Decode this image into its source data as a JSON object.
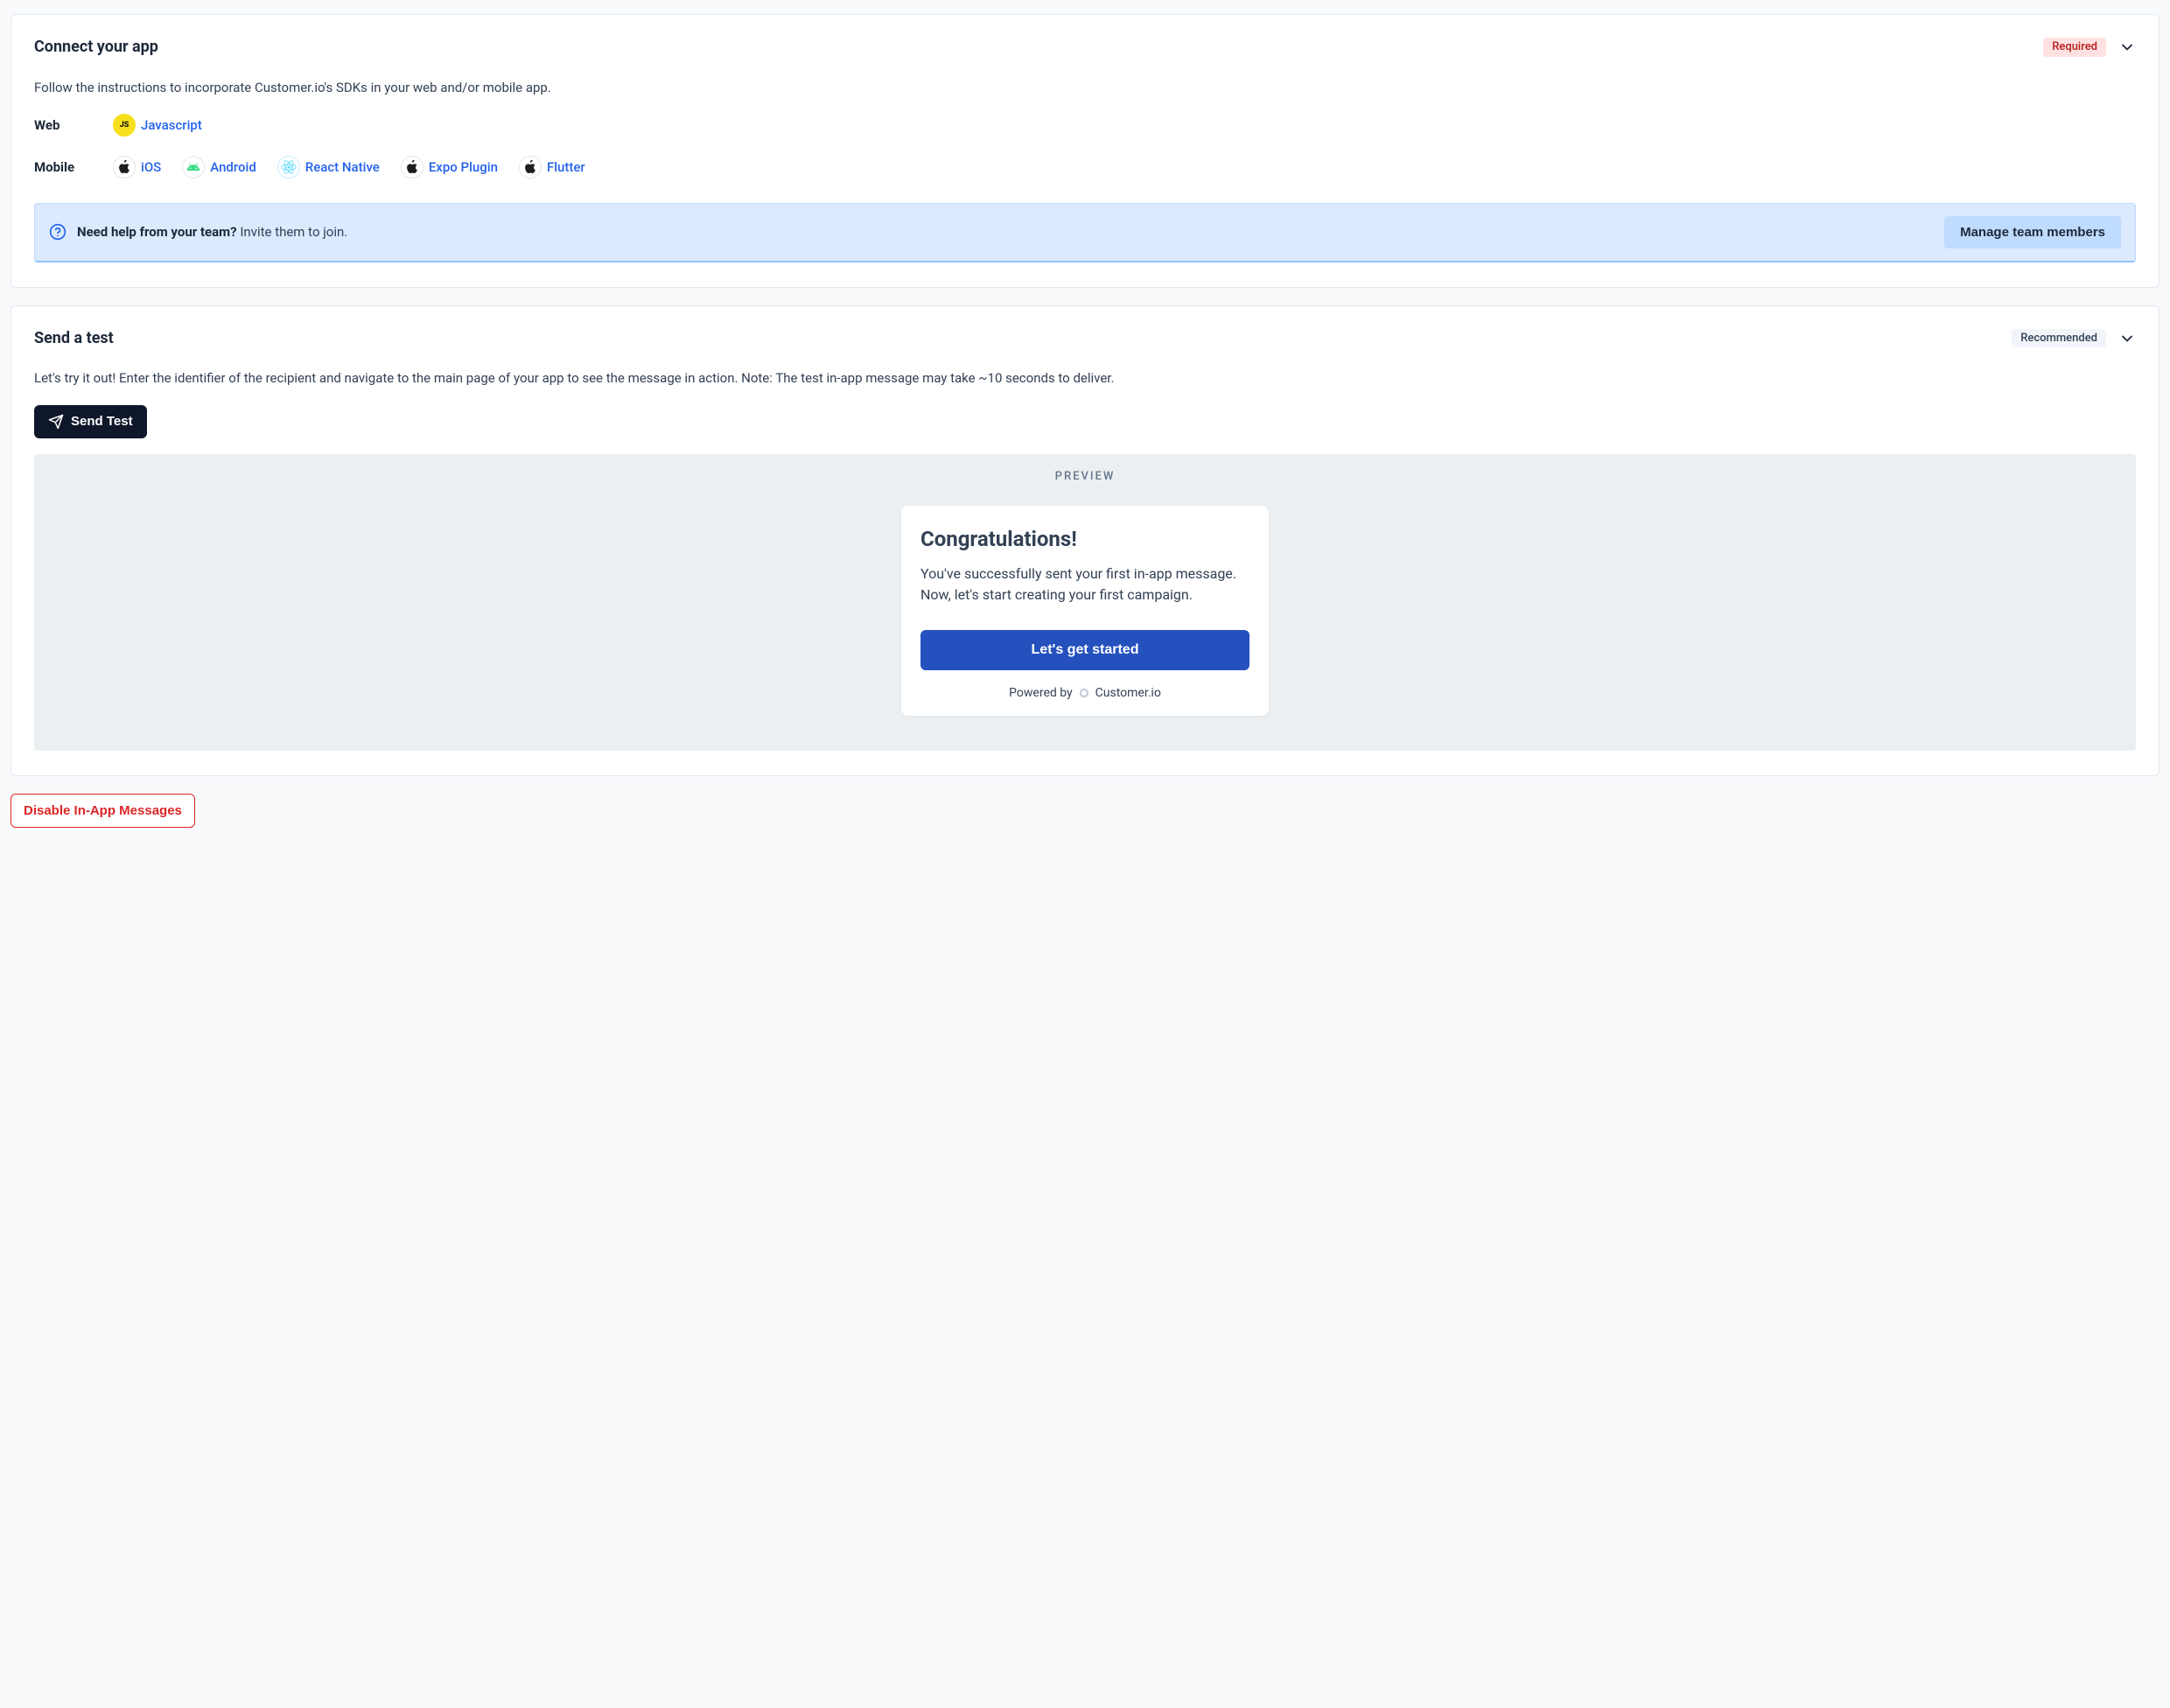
{
  "connect": {
    "title": "Connect your app",
    "badge": "Required",
    "description": "Follow the instructions to incorporate Customer.io's SDKs in your web and/or mobile app.",
    "web_label": "Web",
    "mobile_label": "Mobile",
    "web": {
      "js": "Javascript"
    },
    "mobile": {
      "ios": "iOS",
      "android": "Android",
      "react_native": "React Native",
      "expo": "Expo Plugin",
      "flutter": "Flutter"
    },
    "help_banner": {
      "strong": "Need help from your team?",
      "text": " Invite them to join.",
      "action": "Manage team members"
    }
  },
  "test": {
    "title": "Send a test",
    "badge": "Recommended",
    "description": "Let's try it out! Enter the identifier of the recipient and navigate to the main page of your app to see the message in action. Note: The test in-app message may take ~10 seconds to deliver.",
    "send_button": "Send Test",
    "preview_label": "PREVIEW",
    "preview_card": {
      "heading": "Congratulations!",
      "body": "You've successfully sent your first in-app message. Now, let's start creating your first campaign.",
      "cta": "Let's get started",
      "powered_prefix": "Powered by",
      "powered_brand": "Customer.io"
    }
  },
  "footer": {
    "disable": "Disable In-App Messages"
  }
}
